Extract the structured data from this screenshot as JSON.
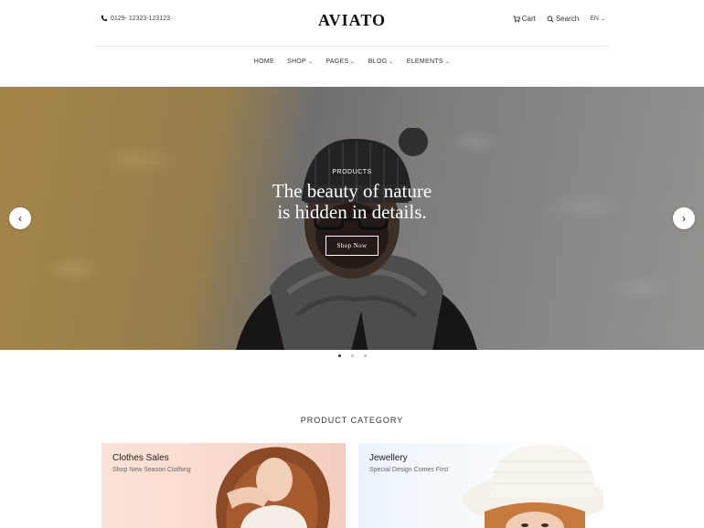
{
  "header": {
    "phone": "0129- 12323-123123",
    "logo": "AVIATO",
    "cart_label": "Cart",
    "search_label": "Search",
    "language": "EN"
  },
  "nav": [
    {
      "label": "HOME",
      "has_dropdown": false
    },
    {
      "label": "SHOP",
      "has_dropdown": true
    },
    {
      "label": "PAGES",
      "has_dropdown": true
    },
    {
      "label": "BLOG",
      "has_dropdown": true
    },
    {
      "label": "ELEMENTS",
      "has_dropdown": true
    }
  ],
  "hero": {
    "eyebrow": "PRODUCTS",
    "title_line1": "The beauty of nature",
    "title_line2": "is hidden in details.",
    "button_label": "Shop Now",
    "prev_icon": "chevron-left-icon",
    "next_icon": "chevron-right-icon",
    "slide_count": 3,
    "active_slide": 1
  },
  "category": {
    "section_title": "PRODUCT CATEGORY",
    "cards": [
      {
        "title": "Clothes Sales",
        "subtitle": "Shop New Season Clothing"
      },
      {
        "title": "Jewellery",
        "subtitle": "Special Design Comes First"
      }
    ]
  },
  "icons": {
    "phone": "phone-icon",
    "cart": "cart-icon",
    "search": "search-icon"
  }
}
